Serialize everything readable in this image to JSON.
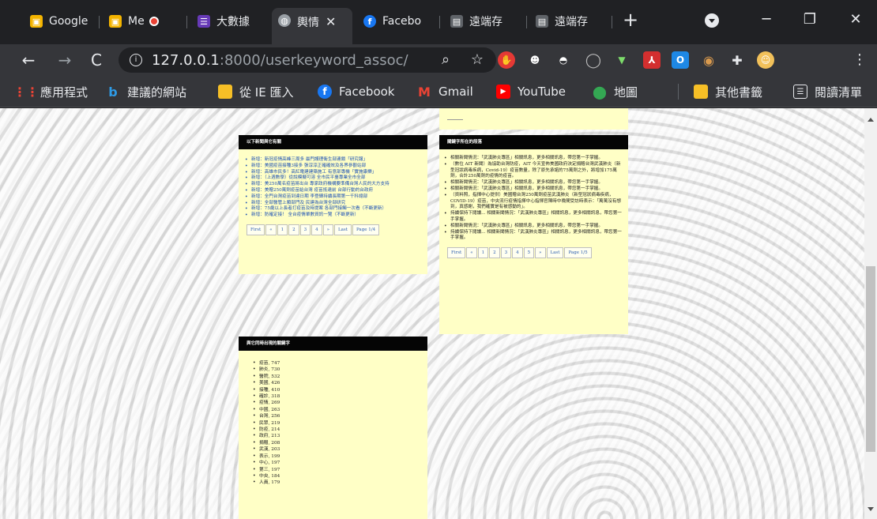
{
  "tabs": [
    {
      "label": "Google",
      "icon": "google-classroom-icon",
      "color": "#f4b400"
    },
    {
      "label": "Me",
      "icon": "google-meet-icon",
      "color": "#f4b400",
      "recording": true
    },
    {
      "label": "大數據",
      "icon": "forms-icon",
      "color": "#673ab7"
    },
    {
      "label": "輿情",
      "icon": "globe-icon",
      "color": "#9aa0a6",
      "active": true,
      "close": "✕"
    },
    {
      "label": "Facebo",
      "icon": "facebook-icon",
      "color": "#1877f2"
    },
    {
      "label": "遠端存",
      "icon": "remote-icon",
      "color": "#5f6368"
    },
    {
      "label": "遠端存",
      "icon": "remote-icon",
      "color": "#5f6368"
    }
  ],
  "new_tab": "+",
  "address": {
    "host": "127.0.0.1",
    "rest": ":8000/userkeyword_assoc/"
  },
  "bookmarks": [
    {
      "label": "應用程式",
      "icon": "apps-grid-icon"
    },
    {
      "label": "建議的網站",
      "icon": "bing-icon"
    },
    {
      "label": "從 IE 匯入",
      "icon": "folder-icon"
    },
    {
      "label": "Facebook",
      "icon": "facebook-icon"
    },
    {
      "label": "Gmail",
      "icon": "gmail-icon"
    },
    {
      "label": "YouTube",
      "icon": "youtube-icon"
    },
    {
      "label": "地圖",
      "icon": "maps-icon"
    },
    {
      "label": "其他書籤",
      "icon": "folder-icon"
    },
    {
      "label": "閱讀清單",
      "icon": "reading-list-icon"
    }
  ],
  "panels": {
    "news": {
      "title": "以下新聞與它有關",
      "items": [
        "新增：新冠疫情高峰三周多 最門護理衛生部連鎖「研究報」",
        "新增：美國疫苗接種3接多 張淳淳正確確效及各界參觀站部",
        "新增：高雄市民多！高紅電建建築施工 有意部專機「實施康樂」",
        "新增：（上週數學）從說模擬可溶 全市民平臺專業全市全部",
        "新增：美250萬名疫苗將出台 專家政府機構要準備台灣人民的大方支持",
        "新增：美贈250萬劑疫苗給台灣 疫苗抵達前 台部行動的台政府",
        "新增：全門台灣疫苗到達日期 李登輝持續長期第一千科總部",
        "新增：全部醫管上類部門及 民建為台灣全部研究",
        "新增：75歲以上長者打疫苗及時提案 各部門接觸一次看（不斷更新）",
        "新增：防確定接！ 全台疫情單數資訊一覽（不斷更新）"
      ],
      "pager": [
        "First",
        "«",
        "1",
        "2",
        "3",
        "4",
        "»",
        "Last",
        "Page 1/4"
      ]
    },
    "keywords": {
      "title": "關鍵字所在的段落",
      "items": [
        "相關新聞情況：「武漢肺炎專區」相關訊息，更多相關訊息，帶您第一手掌握。",
        "（數位 AIT 新聞）為協助台灣防疫，AIT 今天宣佈美國政府決定捐贈台灣武漢肺炎（新型冠狀病毒疾病，Covid-19）疫苗數量，除了原先承諾的75萬劑之外，將增加175萬劑，合計250萬劑的疫情的疫苗。",
        "相關新聞情況：「武漢肺炎專區」相關訊息，更多相關訊息，帶您第一手掌握。",
        "相關新聞情況：「武漢肺炎專區」相關訊息，更多相關訊息，帶您第一手掌握。",
        "（資料照，指揮中心提供）美國贈台灣250萬劑疫苗武漢肺炎（新型冠狀病毒疾病，COVID-19）疫苗，中央流行疫情指揮中心指揮官陳時中晚間受訪時表示：「萬萬沒有想到，真感謝，我們確實是有被感動的」。",
        "持續保持下閱讀... 相關新聞情況：「武漢肺炎專區」相關訊息，更多相關訊息，帶您第一手掌握。",
        "相關新聞情況：「武漢肺炎專區」相關訊息，更多相關訊息，帶您第一手掌握。",
        "持續保持下閱讀... 相關新聞情況：「武漢肺炎專區」相關訊息，更多相關訊息，帶您第一手掌握。"
      ],
      "pager": [
        "First",
        "«",
        "1",
        "2",
        "3",
        "4",
        "5",
        "»",
        "Last",
        "Page 1/5"
      ]
    },
    "cooccur": {
      "title": "與它同時出現的關鍵字",
      "items": [
        "疫苗, 747",
        "肺炎, 730",
        "醫院, 532",
        "美國, 426",
        "接種, 410",
        "確診, 318",
        "疫情, 269",
        "中國, 263",
        "台灣, 256",
        "民眾, 219",
        "防疫, 214",
        "政府, 213",
        "捐贈, 208",
        "武漢, 203",
        "表示, 199",
        "中心, 197",
        "第三, 197",
        "中央, 184",
        "人員, 179"
      ]
    }
  }
}
